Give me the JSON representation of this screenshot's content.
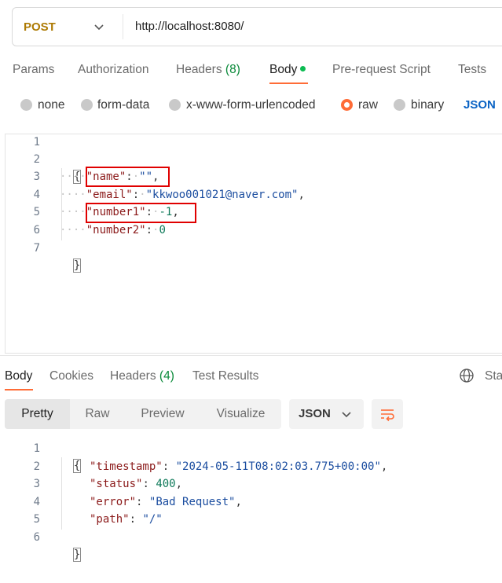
{
  "request": {
    "method": "POST",
    "url": "http://localhost:8080/"
  },
  "request_tabs": {
    "params": "Params",
    "authorization": "Authorization",
    "headers_label": "Headers",
    "headers_count": "(8)",
    "body": "Body",
    "prerequest": "Pre-request Script",
    "tests": "Tests"
  },
  "body_types": {
    "none": "none",
    "form_data": "form-data",
    "urlencoded": "x-www-form-urlencoded",
    "raw": "raw",
    "binary": "binary",
    "format": "JSON"
  },
  "request_body": {
    "line_numbers": [
      "1",
      "2",
      "3",
      "4",
      "5",
      "6",
      "7"
    ],
    "open_brace": "{",
    "close_brace": "}",
    "name_key": "\"name\"",
    "name_value": "\"\"",
    "email_key": "\"email\"",
    "email_value": "\"kkwoo001021@naver.com\"",
    "number1_key": "\"number1\"",
    "number1_value": "-1",
    "number2_key": "\"number2\"",
    "number2_value": "0",
    "colon": ":",
    "comma": ","
  },
  "response_tabs": {
    "body": "Body",
    "cookies": "Cookies",
    "headers_label": "Headers",
    "headers_count": "(4)",
    "test_results": "Test Results",
    "status_clipped": "Sta"
  },
  "response_view": {
    "pretty": "Pretty",
    "raw": "Raw",
    "preview": "Preview",
    "visualize": "Visualize",
    "format": "JSON"
  },
  "response_body": {
    "line_numbers": [
      "1",
      "2",
      "3",
      "4",
      "5",
      "6"
    ],
    "open_brace": "{",
    "close_brace": "}",
    "timestamp_key": "\"timestamp\"",
    "timestamp_value": "\"2024-05-11T08:02:03.775+00:00\"",
    "status_key": "\"status\"",
    "status_value": "400",
    "error_key": "\"error\"",
    "error_value": "\"Bad Request\"",
    "path_key": "\"path\"",
    "path_value": "\"/\"",
    "colon": ":",
    "comma": ","
  },
  "colors": {
    "accent": "#ff6c37",
    "method": "#ad7a03",
    "json_blue": "#0b63c4",
    "count_green": "#0a8a3a",
    "highlight_red": "#e00000"
  }
}
